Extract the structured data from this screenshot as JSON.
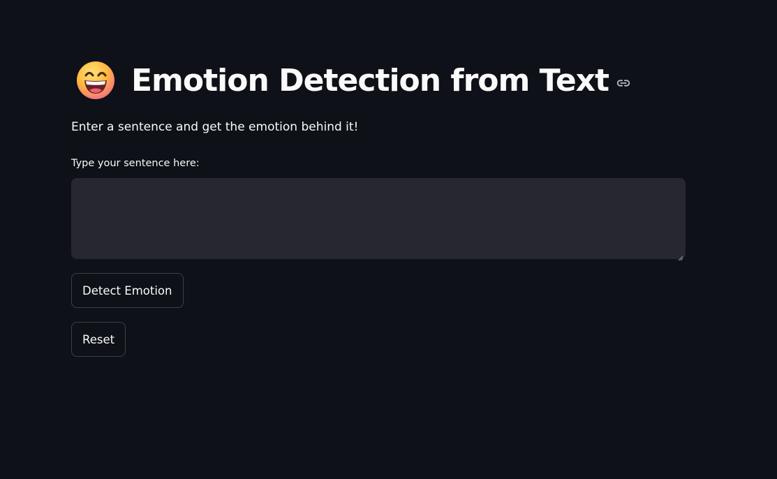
{
  "header": {
    "emoji_icon": "grinning-face-with-smiling-eyes-icon",
    "title": "Emotion Detection from Text",
    "anchor_icon": "link-icon"
  },
  "intro": {
    "subtitle": "Enter a sentence and get the emotion behind it!"
  },
  "form": {
    "label": "Type your sentence here:",
    "value": "",
    "placeholder": ""
  },
  "buttons": {
    "detect_label": "Detect Emotion",
    "reset_label": "Reset"
  },
  "colors": {
    "background": "#0e1117",
    "input_background": "#262730",
    "button_border": "#3c3f4a",
    "text": "#fafafa"
  }
}
